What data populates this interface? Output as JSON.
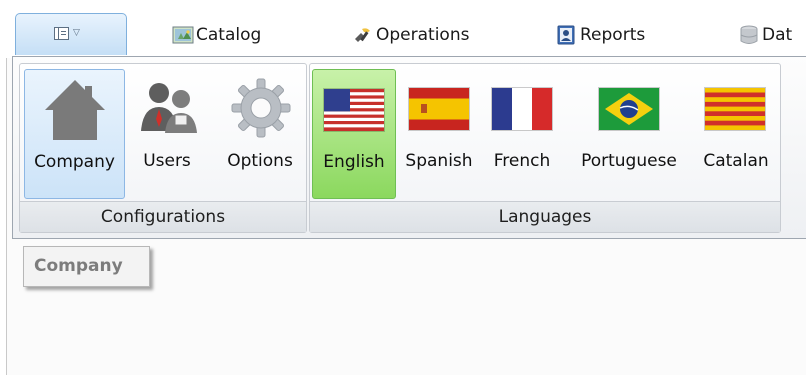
{
  "tabs": [
    {
      "label": "Catalog",
      "icon": "catalog-icon"
    },
    {
      "label": "Operations",
      "icon": "operations-icon"
    },
    {
      "label": "Reports",
      "icon": "reports-icon"
    },
    {
      "label": "Dat",
      "icon": "database-icon"
    }
  ],
  "app_menu": {
    "icon": "application-menu-icon"
  },
  "ribbon": {
    "groups": [
      {
        "label": "Configurations",
        "buttons": [
          {
            "label": "Company",
            "icon": "house-icon",
            "selected": true
          },
          {
            "label": "Users",
            "icon": "users-icon"
          },
          {
            "label": "Options",
            "icon": "gear-icon"
          }
        ]
      },
      {
        "label": "Languages",
        "buttons": [
          {
            "label": "English",
            "icon": "us-flag-icon",
            "selected": true
          },
          {
            "label": "Spanish",
            "icon": "spain-flag-icon"
          },
          {
            "label": "French",
            "icon": "france-flag-icon"
          },
          {
            "label": "Portuguese",
            "icon": "brazil-flag-icon"
          },
          {
            "label": "Catalan",
            "icon": "catalonia-flag-icon"
          }
        ]
      }
    ]
  },
  "tooltip": {
    "text": "Company"
  },
  "colors": {
    "accent_blue": "#cce3f8",
    "accent_green": "#8bd85e"
  }
}
